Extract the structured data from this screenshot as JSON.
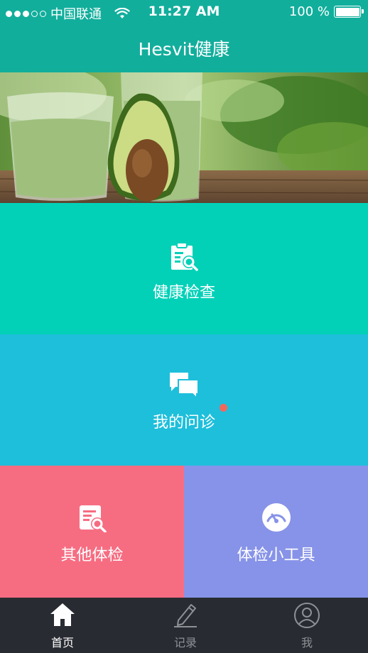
{
  "status_bar": {
    "carrier": "中国联通",
    "time": "11:27 AM",
    "battery": "100 %"
  },
  "header": {
    "title": "Hesvit健康"
  },
  "tiles": {
    "checkup": {
      "label": "健康检查",
      "color": "#02d1b8"
    },
    "consult": {
      "label": "我的问诊",
      "color": "#1ebfdb",
      "badge_color": "#f2685c"
    },
    "other": {
      "label": "其他体检",
      "color": "#f66d82"
    },
    "tools": {
      "label": "体检小工具",
      "color": "#8793e8"
    }
  },
  "tabbar": {
    "items": [
      {
        "label": "首页",
        "icon": "home-icon",
        "active": true
      },
      {
        "label": "记录",
        "icon": "pencil-icon",
        "active": false
      },
      {
        "label": "我",
        "icon": "user-icon",
        "active": false
      }
    ]
  }
}
